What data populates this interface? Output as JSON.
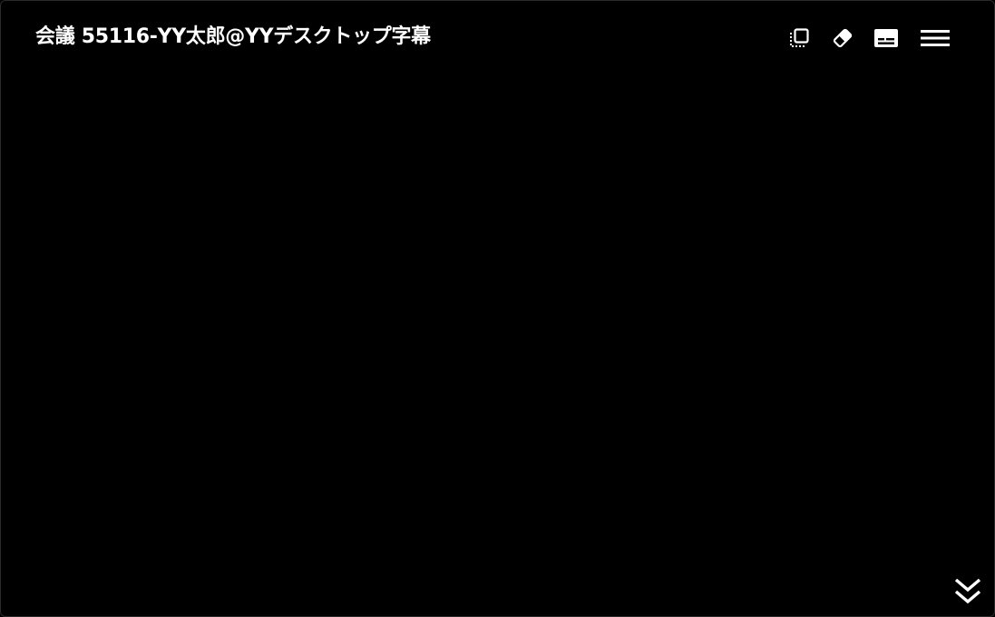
{
  "window": {
    "title": "会議 55116-YY太郎@YYデスクトップ字幕"
  },
  "toolbar": {
    "buttons": [
      {
        "icon": "copy-icon"
      },
      {
        "icon": "eraser-icon"
      },
      {
        "icon": "subtitles-icon"
      },
      {
        "icon": "hamburger-menu-icon"
      }
    ]
  },
  "footer": {
    "scroll_icon": "double-chevron-down-icon"
  },
  "colors": {
    "background": "#000000",
    "foreground": "#ffffff"
  }
}
